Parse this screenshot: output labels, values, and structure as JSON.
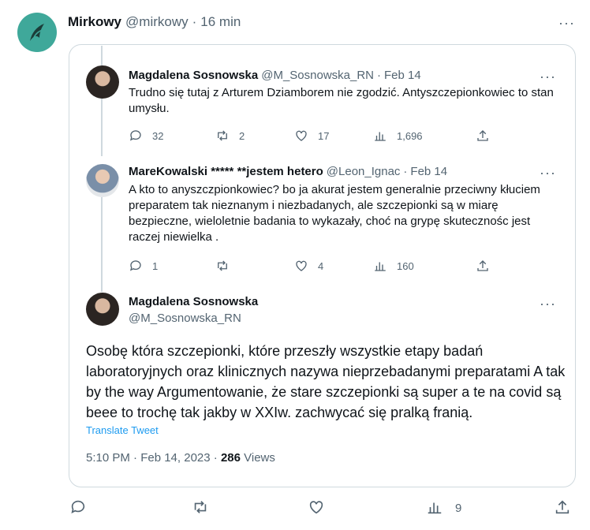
{
  "outer_tweet": {
    "name": "Mirkowy",
    "handle": "@mirkowy",
    "sep": "·",
    "time": "16 min",
    "bottom_views": "9"
  },
  "thread": [
    {
      "name": "Magdalena Sosnowska",
      "handle": "@M_Sosnowska_RN",
      "sep": "·",
      "date": "Feb 14",
      "text": "Trudno się tutaj z Arturem Dziamborem nie zgodzić. Antyszczepionkowiec to stan umysłu.",
      "replies": "32",
      "retweets": "2",
      "likes": "17",
      "views": "1,696"
    },
    {
      "name": "MareKowalski ***** **jestem hetero",
      "handle": "@Leon_Ignac",
      "sep": "·",
      "date": "Feb 14",
      "text": "A kto to anyszczpionkowiec? bo ja akurat jestem generalnie przeciwny kłuciem preparatem tak nieznanym i niezbadanych, ale szczepionki są w miarę bezpieczne, wieloletnie badania to wykazały, choć na grypę skutecznośc jest raczej niewielka .",
      "replies": "1",
      "retweets": "",
      "likes": "4",
      "views": "160"
    }
  ],
  "main_tweet": {
    "name": "Magdalena Sosnowska",
    "handle": "@M_Sosnowska_RN",
    "text": "Osobę która szczepionki, które przeszły wszystkie etapy badań laboratoryjnych oraz klinicznych nazywa nieprzebadanymi preparatami A tak by the way Argumentowanie, że stare szczepionki są super a te na covid są beee to trochę tak jakby w XXIw. zachwycać się pralką franią.",
    "translate": "Translate Tweet",
    "time": "5:10 PM · Feb 14, 2023 · ",
    "views_count": "286",
    "views_label": " Views"
  },
  "more_label": "···"
}
